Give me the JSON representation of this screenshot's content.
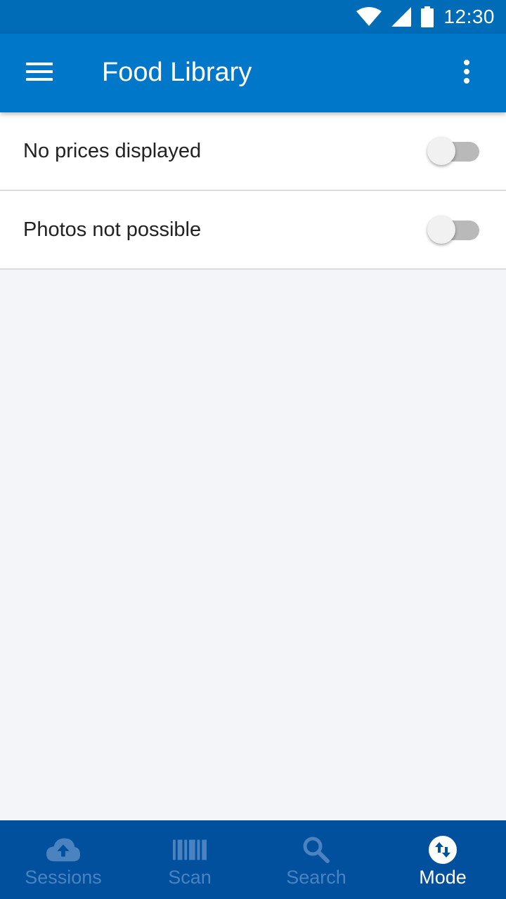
{
  "status_bar": {
    "time": "12:30",
    "icons": [
      "wifi-icon",
      "signal-icon",
      "battery-icon"
    ]
  },
  "app_bar": {
    "title": "Food Library",
    "menu_icon": "hamburger-menu-icon",
    "overflow_icon": "more-vert-icon"
  },
  "settings": [
    {
      "label": "No prices displayed",
      "enabled": false
    },
    {
      "label": "Photos not possible",
      "enabled": false
    }
  ],
  "bottom_nav": {
    "items": [
      {
        "label": "Sessions",
        "icon": "cloud-upload-icon",
        "active": false
      },
      {
        "label": "Scan",
        "icon": "barcode-icon",
        "active": false
      },
      {
        "label": "Search",
        "icon": "search-icon",
        "active": false
      },
      {
        "label": "Mode",
        "icon": "swap-vertical-icon",
        "active": true
      }
    ]
  },
  "colors": {
    "status_bar": "#006bb6",
    "app_bar": "#0077c8",
    "bottom_nav": "#00509d",
    "nav_inactive": "#4b82c0",
    "nav_active": "#ffffff",
    "background": "#f4f5f8"
  }
}
